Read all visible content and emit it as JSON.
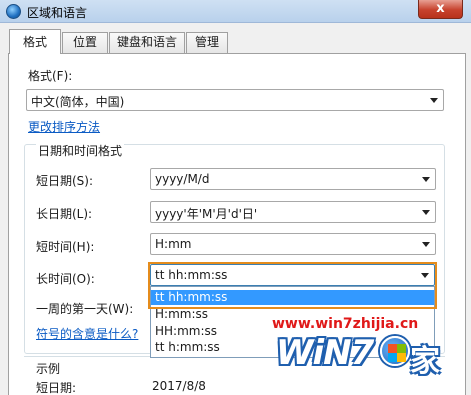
{
  "window": {
    "title": "区域和语言",
    "close_glyph": "x",
    "icon": "globe-icon"
  },
  "tabs": [
    {
      "label": "格式",
      "active": true
    },
    {
      "label": "位置",
      "active": false
    },
    {
      "label": "键盘和语言",
      "active": false
    },
    {
      "label": "管理",
      "active": false
    }
  ],
  "format": {
    "label": "格式(F):",
    "value": "中文(简体，中国)",
    "sort_link": "更改排序方法"
  },
  "datetime": {
    "group_title": "日期和时间格式",
    "short_date": {
      "label": "短日期(S):",
      "value": "yyyy/M/d"
    },
    "long_date": {
      "label": "长日期(L):",
      "value": "yyyy'年'M'月'd'日'"
    },
    "short_time": {
      "label": "短时间(H):",
      "value": "H:mm"
    },
    "long_time": {
      "label": "长时间(O):",
      "value": "tt hh:mm:ss"
    },
    "first_day": {
      "label": "一周的第一天(W):"
    },
    "symbols_link": "符号的含意是什么?"
  },
  "long_time_dropdown": {
    "options": [
      "tt hh:mm:ss",
      "H:mm:ss",
      "HH:mm:ss",
      "tt h:mm:ss"
    ],
    "selected_index": 0
  },
  "examples": {
    "title": "示例",
    "short_date_label": "短日期:",
    "short_date_value": "2017/8/8"
  },
  "watermark": {
    "url": "www.win7zhijia.cn",
    "logo_text": "WiN7",
    "logo_char": "家"
  },
  "colors": {
    "accent_highlight": "#e58c1c",
    "selection": "#3399ff",
    "link": "#0b5bc4",
    "watermark_red": "#e01919"
  }
}
